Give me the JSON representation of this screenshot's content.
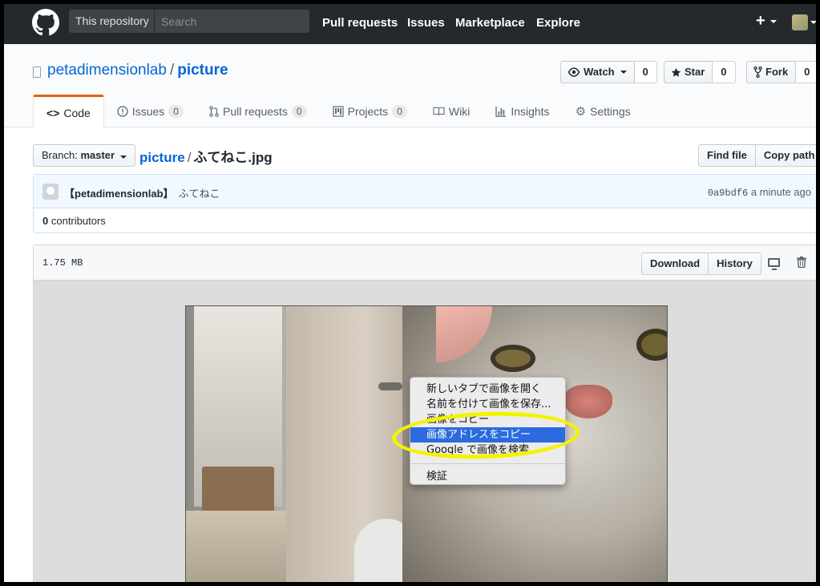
{
  "header": {
    "scope_label": "This repository",
    "search_placeholder": "Search",
    "nav": [
      "Pull requests",
      "Issues",
      "Marketplace",
      "Explore"
    ],
    "plus": "+"
  },
  "repo": {
    "owner": "petadimensionlab",
    "separator": "/",
    "name": "picture",
    "watch_label": "Watch",
    "watch_count": "0",
    "star_label": "Star",
    "star_count": "0",
    "fork_label": "Fork",
    "fork_count": "0"
  },
  "tabs": [
    {
      "label": "Code",
      "icon": "code-icon"
    },
    {
      "label": "Issues",
      "count": "0",
      "icon": "issue-icon"
    },
    {
      "label": "Pull requests",
      "count": "0",
      "icon": "pull-request-icon"
    },
    {
      "label": "Projects",
      "count": "0",
      "icon": "project-icon"
    },
    {
      "label": "Wiki",
      "icon": "book-icon"
    },
    {
      "label": "Insights",
      "icon": "graph-icon"
    },
    {
      "label": "Settings",
      "icon": "gear-icon"
    }
  ],
  "file_nav": {
    "branch_prefix": "Branch:",
    "branch": "master",
    "breadcrumb_repo": "picture",
    "breadcrumb_sep": "/",
    "breadcrumb_file": "ふてねこ.jpg",
    "find_file": "Find file",
    "copy_path": "Copy path"
  },
  "commit": {
    "author": "【petadimensionlab】",
    "message": "ふてねこ",
    "sha": "0a9bdf6",
    "time": "a minute ago",
    "contributors_count": "0",
    "contributors_label": "contributors"
  },
  "file": {
    "size": "1.75 MB",
    "download": "Download",
    "history": "History"
  },
  "context_menu": {
    "items": [
      "新しいタブで画像を開く",
      "名前を付けて画像を保存...",
      "画像をコピー",
      "画像アドレスをコピー",
      "Google で画像を検索"
    ],
    "highlighted_index": 3,
    "inspect": "検証"
  },
  "colors": {
    "header_bg": "#24292e",
    "link": "#0366d6",
    "tab_accent": "#e36209",
    "menu_highlight": "#2b6bde",
    "annotation_ring": "#f3f300"
  }
}
